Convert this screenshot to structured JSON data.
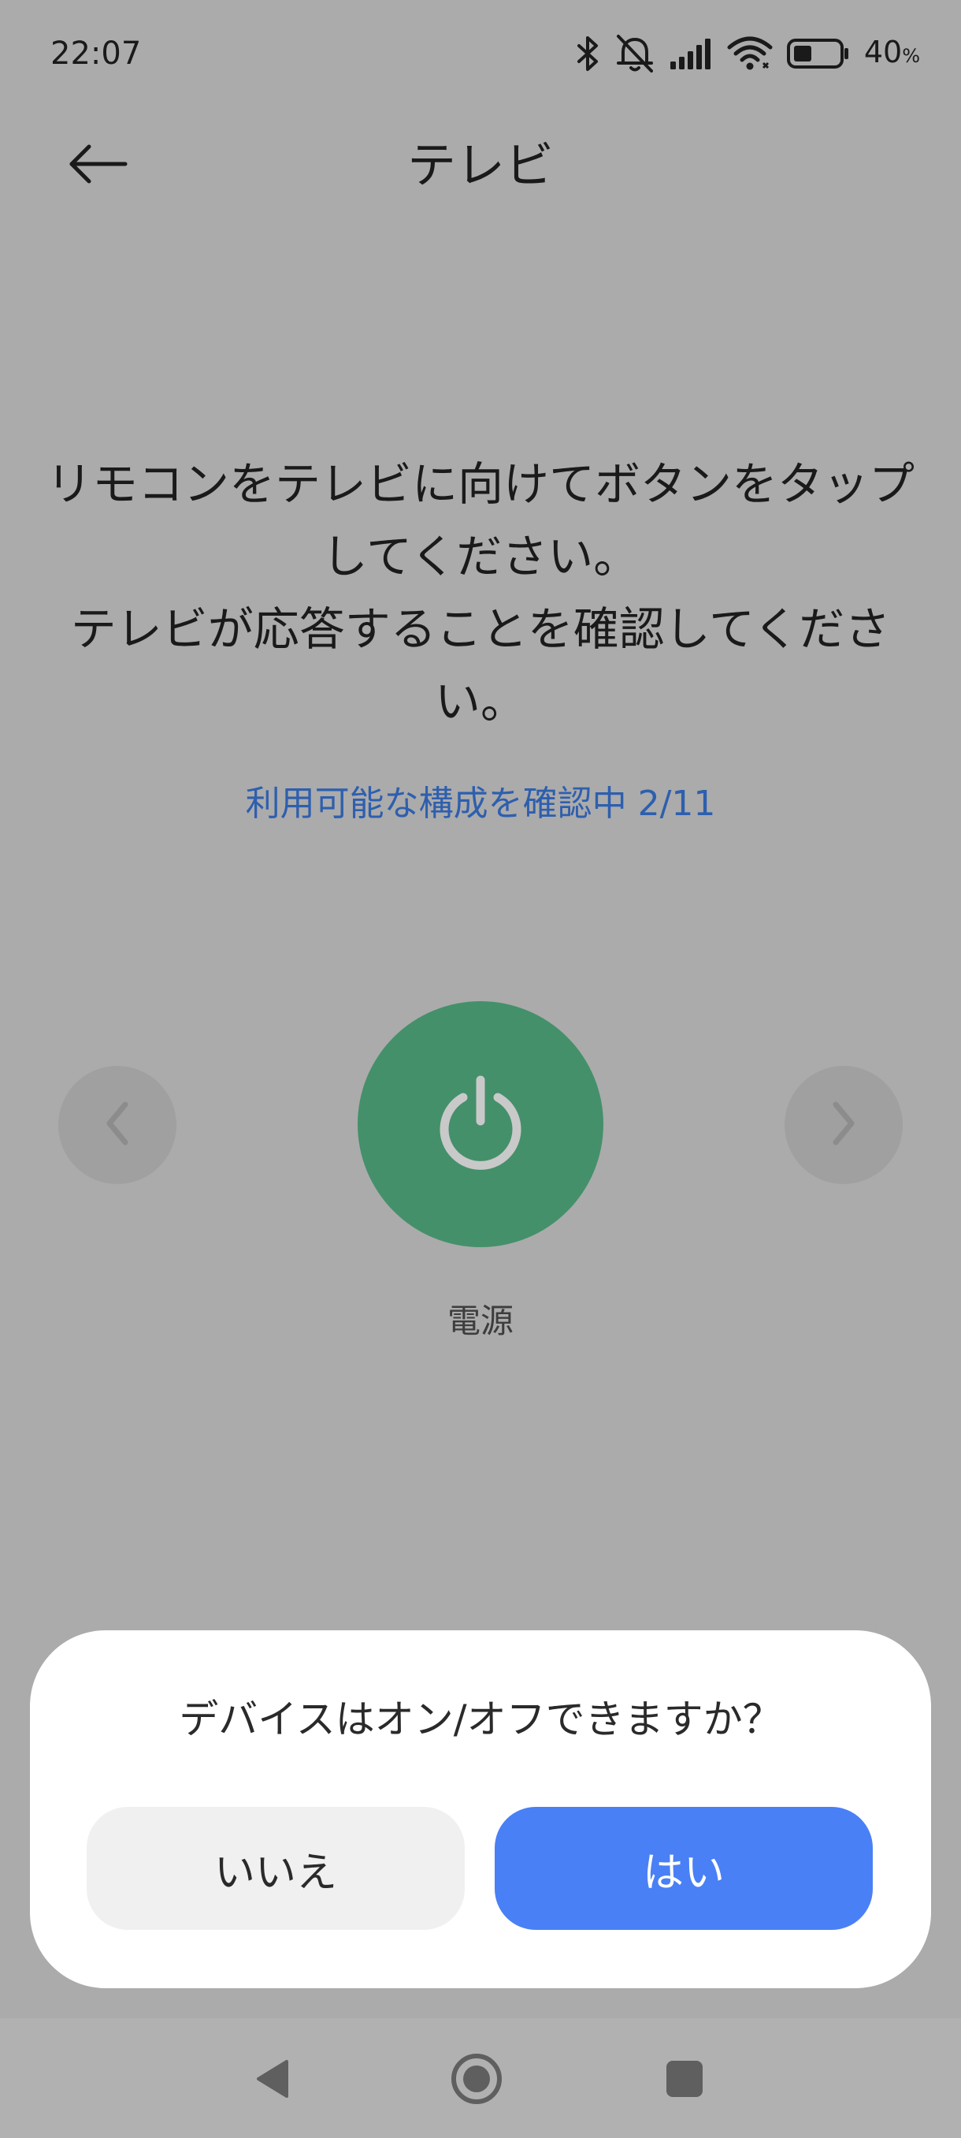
{
  "status_bar": {
    "time": "22:07",
    "battery_percent": "40",
    "battery_unit": "%",
    "battery_level": 0.4,
    "icons": [
      "bluetooth-icon",
      "silent-mode-icon",
      "cellular-signal-icon",
      "wifi-icon",
      "battery-icon"
    ]
  },
  "header": {
    "title": "テレビ",
    "back_icon": "arrow-left-icon"
  },
  "main": {
    "instruction": "リモコンをテレビに向けてボタンをタップ\nしてください。\nテレビが応答することを確認してくださ\nい。",
    "progress_status": "利用可能な構成を確認中 2/11",
    "test_button": {
      "label": "電源",
      "icon": "power-icon",
      "color": "#44906a"
    },
    "prev_icon": "chevron-left-icon",
    "next_icon": "chevron-right-icon"
  },
  "dialog": {
    "question": "デバイスはオン/オフできますか？",
    "no_label": "いいえ",
    "yes_label": "はい",
    "yes_color": "#4a80f5"
  },
  "system_nav": {
    "icons": [
      "back-triangle-icon",
      "home-circle-icon",
      "recents-square-icon"
    ]
  }
}
